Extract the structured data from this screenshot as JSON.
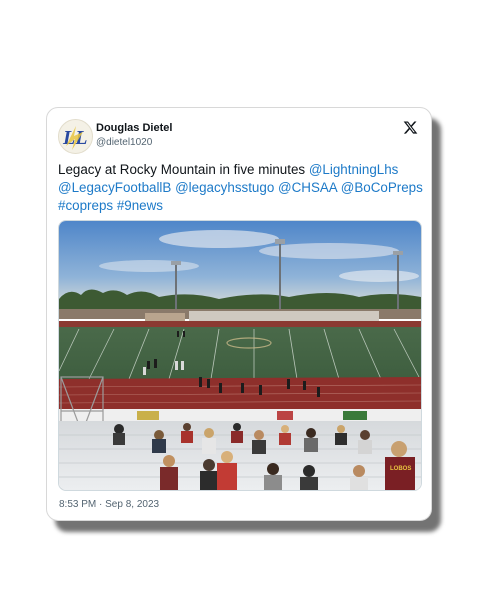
{
  "author": {
    "display_name": "Douglas Dietel",
    "handle": "@dietel1020",
    "avatar_monogram": "LL"
  },
  "tweet": {
    "text_intro": "Legacy at Rocky Mountain  in five minutes ",
    "mentions": [
      "@LightningLhs",
      "@LegacyFootballB",
      "@legacyhsstugo",
      "@CHSAA",
      "@BoCoPreps"
    ],
    "hashtags": [
      "#copreps",
      "#9news"
    ]
  },
  "timestamp": "8:53 PM · Sep 8, 2023",
  "photo": {
    "description_icon": "football-stadium-photo",
    "shirt_text": "LOBOS"
  },
  "icons": {
    "brand": "x-logo-icon"
  },
  "colors": {
    "link": "#1d7ac8",
    "text": "#0f1419",
    "muted": "#536471"
  }
}
